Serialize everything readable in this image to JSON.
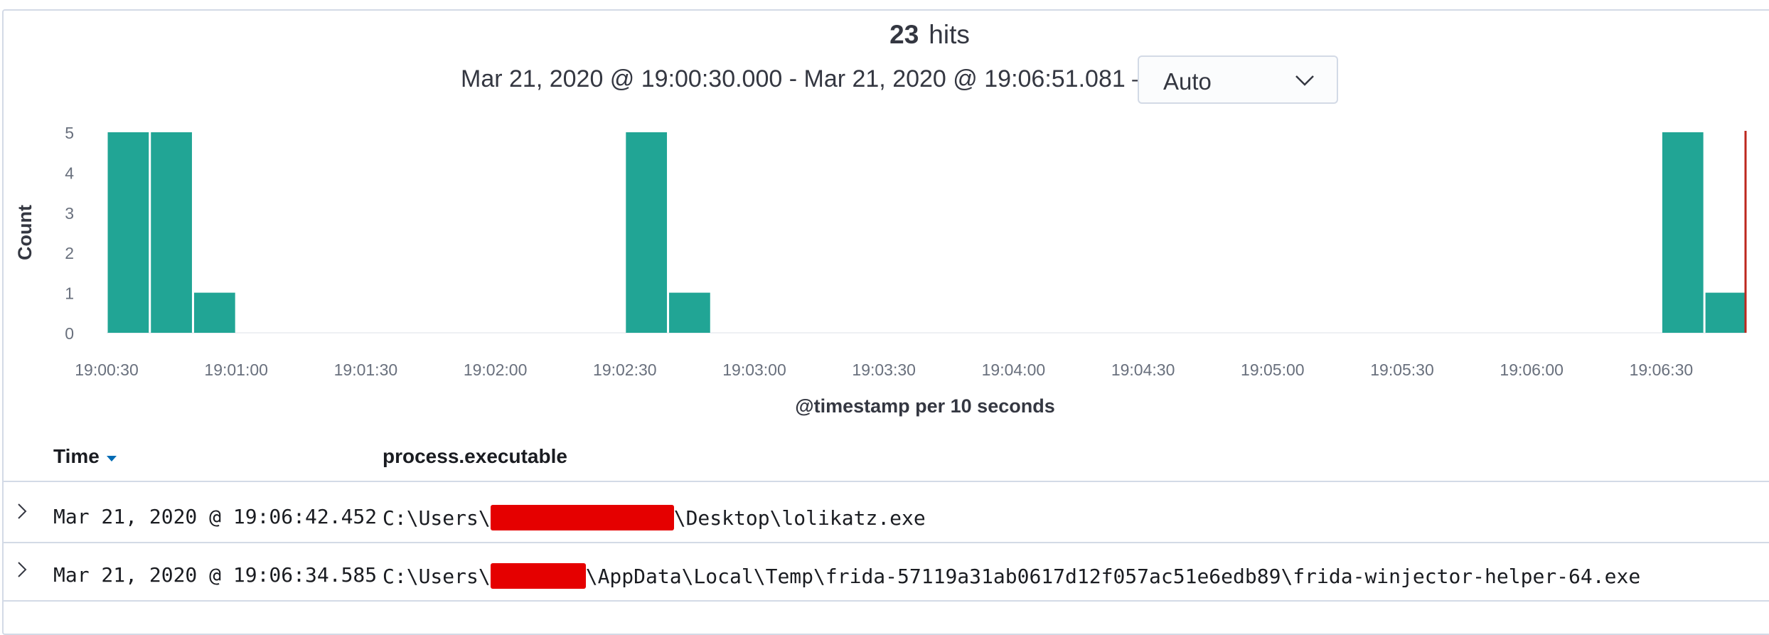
{
  "header": {
    "hits_count": "23",
    "hits_label": "hits",
    "range_text": "Mar 21, 2020 @ 19:00:30.000 - Mar 21, 2020 @ 19:06:51.081 —",
    "interval_value": "Auto"
  },
  "chart_data": {
    "type": "bar",
    "xlabel": "@timestamp per 10 seconds",
    "ylabel": "Count",
    "ylim": [
      0,
      5
    ],
    "y_ticks": [
      "0",
      "1",
      "2",
      "3",
      "4",
      "5"
    ],
    "x_ticks": [
      "19:00:30",
      "19:01:00",
      "19:01:30",
      "19:02:00",
      "19:02:30",
      "19:03:00",
      "19:03:30",
      "19:04:00",
      "19:04:30",
      "19:05:00",
      "19:05:30",
      "19:06:00",
      "19:06:30"
    ],
    "bar_color": "#21a595",
    "now_marker_color": "#bd271e",
    "bars": [
      {
        "bucket": "19:00:30",
        "value": 5
      },
      {
        "bucket": "19:00:40",
        "value": 5
      },
      {
        "bucket": "19:00:50",
        "value": 1
      },
      {
        "bucket": "19:02:30",
        "value": 5
      },
      {
        "bucket": "19:02:40",
        "value": 1
      },
      {
        "bucket": "19:06:30",
        "value": 5
      },
      {
        "bucket": "19:06:40",
        "value": 1
      }
    ]
  },
  "table": {
    "columns": [
      "Time",
      "process.executable"
    ],
    "rows": [
      {
        "time": "Mar 21, 2020 @ 19:06:42.452",
        "exe_prefix": "C:\\Users\\",
        "exe_suffix": "\\Desktop\\lolikatz.exe"
      },
      {
        "time": "Mar 21, 2020 @ 19:06:34.585",
        "exe_prefix": "C:\\Users\\",
        "exe_suffix": "\\AppData\\Local\\Temp\\frida-57119a31ab0617d12f057ac51e6edb89\\frida-winjector-helper-64.exe"
      }
    ]
  }
}
